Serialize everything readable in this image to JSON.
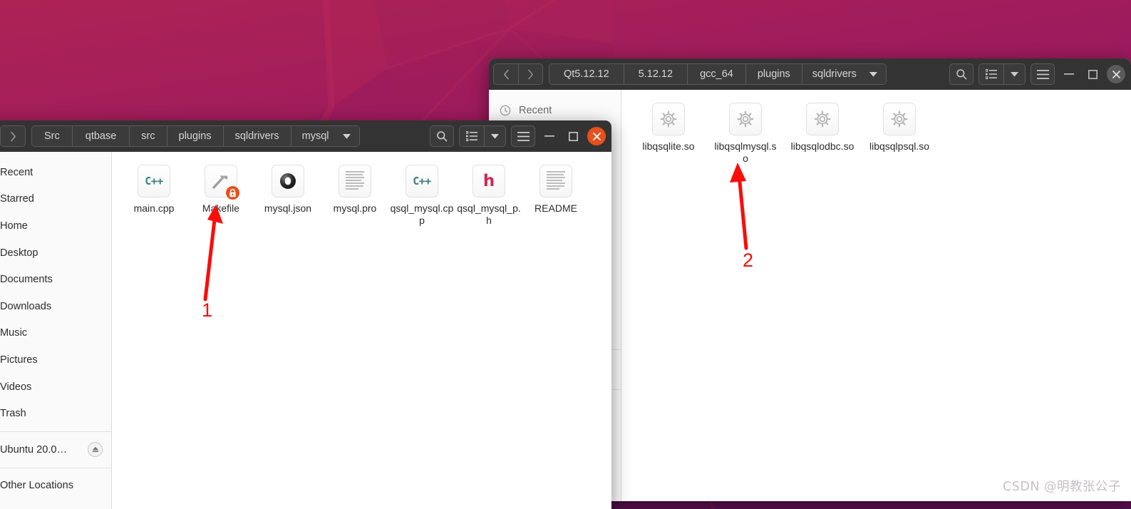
{
  "desktop": {
    "wallpaper_colors": [
      "#a8205a",
      "#98195f",
      "#7c1560",
      "#5d1050"
    ],
    "accent": "#e8501b"
  },
  "watermark": {
    "text": "CSDN @明教张公子",
    "color": "#c6c0c4"
  },
  "annotations": {
    "arrow_color": "#fb0d08",
    "markers": [
      {
        "label": "1",
        "points_to": "Makefile"
      },
      {
        "label": "2",
        "points_to": "libqsqlmysql.so"
      }
    ]
  },
  "back_window": {
    "name": "files-window-sqldrivers",
    "titlebar": {
      "back_icon": "chevron-left-icon",
      "forward_icon": "chevron-right-icon",
      "breadcrumbs": [
        "Qt5.12.12",
        "5.12.12",
        "gcc_64",
        "plugins",
        "sqldrivers"
      ],
      "caret_icon": "chevron-down-icon",
      "search_icon": "search-icon",
      "view_list_icon": "list-view-icon",
      "view_caret_icon": "chevron-down-icon",
      "menu_icon": "hamburger-menu-icon",
      "minimize_label": "—",
      "maximize_label": "□",
      "close_label": "✕"
    },
    "sidebar": {
      "items": [
        {
          "label": "Recent",
          "icon": "clock-icon"
        }
      ]
    },
    "files": [
      {
        "name": "libqsqlite.so",
        "icon": "shared-library-icon"
      },
      {
        "name": "libqsqlmysql.so",
        "icon": "shared-library-icon"
      },
      {
        "name": "libqsqlodbc.so",
        "icon": "shared-library-icon"
      },
      {
        "name": "libqsqlpsql.so",
        "icon": "shared-library-icon"
      }
    ]
  },
  "front_window": {
    "name": "files-window-mysql",
    "titlebar": {
      "forward_icon": "chevron-right-icon",
      "breadcrumbs": [
        "Src",
        "qtbase",
        "src",
        "plugins",
        "sqldrivers",
        "mysql"
      ],
      "caret_icon": "chevron-down-icon",
      "search_icon": "search-icon",
      "view_list_icon": "list-view-icon",
      "view_caret_icon": "chevron-down-icon",
      "menu_icon": "hamburger-menu-icon",
      "minimize_label": "—",
      "maximize_label": "□",
      "close_label": "✕"
    },
    "sidebar": {
      "items": [
        {
          "label": "Recent",
          "icon": "clock-icon",
          "type": "place"
        },
        {
          "label": "Starred",
          "icon": "star-icon",
          "type": "place"
        },
        {
          "label": "Home",
          "icon": "home-icon",
          "type": "place"
        },
        {
          "label": "Desktop",
          "icon": "desktop-icon",
          "type": "place"
        },
        {
          "label": "Documents",
          "icon": "documents-icon",
          "type": "place"
        },
        {
          "label": "Downloads",
          "icon": "downloads-icon",
          "type": "place"
        },
        {
          "label": "Music",
          "icon": "music-icon",
          "type": "place"
        },
        {
          "label": "Pictures",
          "icon": "pictures-icon",
          "type": "place"
        },
        {
          "label": "Videos",
          "icon": "videos-icon",
          "type": "place"
        },
        {
          "label": "Trash",
          "icon": "trash-icon",
          "type": "place"
        }
      ],
      "devices": [
        {
          "label": "Ubuntu 20.0…",
          "icon": "disk-icon",
          "eject_icon": "eject-icon"
        }
      ],
      "network": [
        {
          "label": "Other Locations",
          "icon": "network-icon"
        }
      ]
    },
    "files": [
      {
        "name": "main.cpp",
        "icon": "cpp-file-icon",
        "badge": ""
      },
      {
        "name": "Makefile",
        "icon": "makefile-icon",
        "badge": "lock-icon"
      },
      {
        "name": "mysql.json",
        "icon": "json-file-icon",
        "badge": ""
      },
      {
        "name": "mysql.pro",
        "icon": "text-file-icon",
        "badge": ""
      },
      {
        "name": "qsql_mysql.cpp",
        "icon": "cpp-file-icon",
        "badge": ""
      },
      {
        "name": "qsql_mysql_p.h",
        "icon": "header-file-icon",
        "badge": ""
      },
      {
        "name": "README",
        "icon": "text-file-icon",
        "badge": ""
      }
    ]
  }
}
